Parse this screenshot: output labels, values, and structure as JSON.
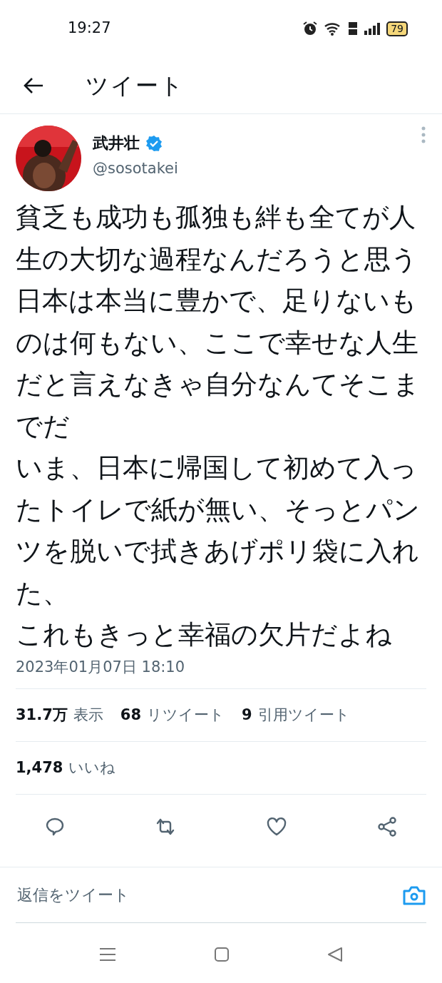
{
  "status_bar": {
    "time": "19:27",
    "battery": "79"
  },
  "header": {
    "title": "ツイート"
  },
  "tweet": {
    "author": {
      "name": "武井壮",
      "verified": true,
      "handle": "@sosotakei"
    },
    "paragraphs": [
      "貧乏も成功も孤独も絆も全てが人生の大切な過程なんだろうと思う",
      "日本は本当に豊かで、足りないものは何もない、ここで幸せな人生だと言えなきゃ自分なんてそこまでだ",
      "いま、日本に帰国して初めて入ったトイレで紙が無い、そっとパンツを脱いで拭きあげポリ袋に入れた、",
      "これもきっと幸福の欠片だよね"
    ],
    "timestamp": "2023年01月07日 18:10",
    "stats_rows": [
      [
        {
          "count": "31.7万",
          "label": "表示"
        },
        {
          "count": "68",
          "label": "リツイート"
        },
        {
          "count": "9",
          "label": "引用ツイート"
        }
      ],
      [
        {
          "count": "1,478",
          "label": "いいね"
        }
      ]
    ],
    "actions": [
      {
        "kind": "reply"
      },
      {
        "kind": "retweet"
      },
      {
        "kind": "like"
      },
      {
        "kind": "share"
      }
    ]
  },
  "reply_bar": {
    "placeholder": "返信をツイート"
  }
}
